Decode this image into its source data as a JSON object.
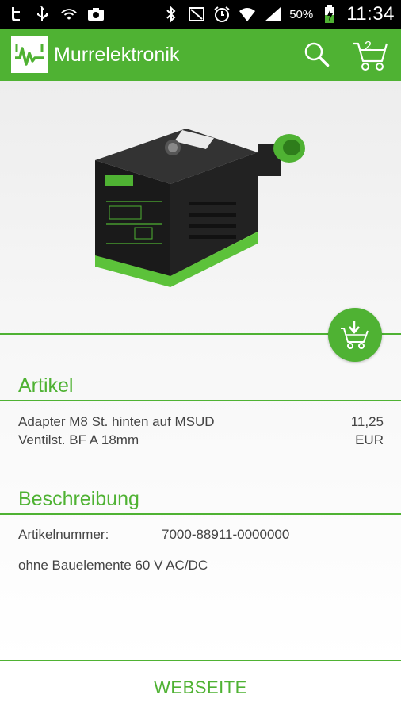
{
  "status_bar": {
    "battery_percent": "50%",
    "time": "11:34",
    "icons": [
      "twitter-icon",
      "usb-icon",
      "wifi-hotspot-icon",
      "photo-icon",
      "bluetooth-icon",
      "nfc-mute-icon",
      "alarm-icon",
      "wifi-icon",
      "signal-icon",
      "battery-charging-icon"
    ]
  },
  "app_bar": {
    "title": "Murrelektronik",
    "cart_count": "2",
    "colors": {
      "primary": "#4fb233"
    }
  },
  "article": {
    "section_title": "Artikel",
    "name_line1": "Adapter M8 St. hinten auf MSUD",
    "name_line2": "Ventilst. BF A 18mm",
    "price": "11,25",
    "currency": "EUR"
  },
  "description": {
    "section_title": "Beschreibung",
    "article_number_label": "Artikelnummer:",
    "article_number_value": "7000-88911-0000000",
    "text": "ohne Bauelemente 60 V AC/DC"
  },
  "footer": {
    "website_button": "WEBSEITE"
  }
}
